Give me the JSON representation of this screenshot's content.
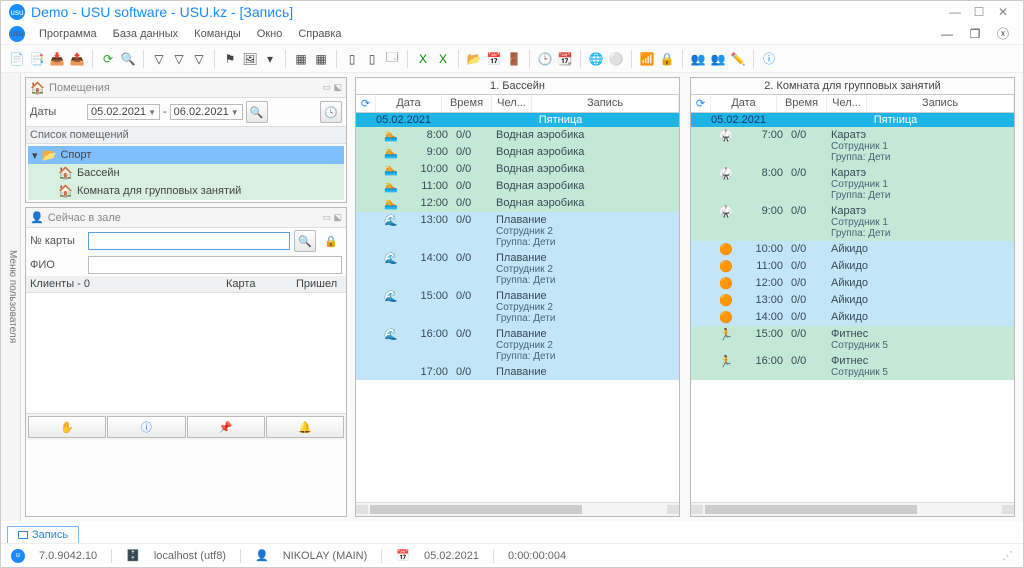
{
  "window_title": "Demo - USU software - USU.kz - [Запись]",
  "menubar": [
    "Программа",
    "База данных",
    "Команды",
    "Окно",
    "Справка"
  ],
  "usermenu_label": "Меню пользователя",
  "rooms_panel": {
    "title": "Помещения",
    "dates_label": "Даты",
    "date_from": "05.02.2021",
    "date_to": "06.02.2021",
    "list_title": "Список помещений",
    "tree": {
      "root": "Спорт",
      "items": [
        "Бассейн",
        "Комната для групповых занятий"
      ]
    }
  },
  "now_panel": {
    "title": "Сейчас в зале",
    "card_label": "№ карты",
    "fio_label": "ФИО",
    "clients_label": "Клиенты - 0",
    "col_card": "Карта",
    "col_came": "Пришел"
  },
  "sched1": {
    "title": "1. Бассейн",
    "cols": [
      "Дата",
      "Время",
      "Чел...",
      "Запись"
    ],
    "day_date": "05.02.2021",
    "day_name": "Пятница",
    "rows": [
      {
        "bg": 1,
        "ic": "swim",
        "time": "8:00",
        "cap": "0/0",
        "txt": "Водная аэробика"
      },
      {
        "bg": 1,
        "ic": "swim",
        "time": "9:00",
        "cap": "0/0",
        "txt": "Водная аэробика"
      },
      {
        "bg": 1,
        "ic": "swim",
        "time": "10:00",
        "cap": "0/0",
        "txt": "Водная аэробика"
      },
      {
        "bg": 1,
        "ic": "swim",
        "time": "11:00",
        "cap": "0/0",
        "txt": "Водная аэробика"
      },
      {
        "bg": 1,
        "ic": "swim",
        "time": "12:00",
        "cap": "0/0",
        "txt": "Водная аэробика"
      },
      {
        "bg": 2,
        "ic": "wave",
        "time": "13:00",
        "cap": "0/0",
        "txt": "Плавание",
        "sub": "Сотрудник 2\nГруппа: Дети"
      },
      {
        "bg": 2,
        "ic": "wave",
        "time": "14:00",
        "cap": "0/0",
        "txt": "Плавание",
        "sub": "Сотрудник 2\nГруппа: Дети"
      },
      {
        "bg": 2,
        "ic": "wave",
        "time": "15:00",
        "cap": "0/0",
        "txt": "Плавание",
        "sub": "Сотрудник 2\nГруппа: Дети"
      },
      {
        "bg": 2,
        "ic": "wave",
        "time": "16:00",
        "cap": "0/0",
        "txt": "Плавание",
        "sub": "Сотрудник 2\nГруппа: Дети"
      },
      {
        "bg": 2,
        "ic": "",
        "time": "17:00",
        "cap": "0/0",
        "txt": "Плавание"
      }
    ]
  },
  "sched2": {
    "title": "2. Комната для групповых занятий",
    "cols": [
      "Дата",
      "Время",
      "Чел...",
      "Запись"
    ],
    "day_date": "05.02.2021",
    "day_name": "Пятница",
    "rows": [
      {
        "bg": 1,
        "ic": "karate",
        "time": "7:00",
        "cap": "0/0",
        "txt": "Каратэ",
        "sub": "Сотрудник 1\nГруппа: Дети"
      },
      {
        "bg": 1,
        "ic": "karate",
        "time": "8:00",
        "cap": "0/0",
        "txt": "Каратэ",
        "sub": "Сотрудник 1\nГруппа: Дети"
      },
      {
        "bg": 1,
        "ic": "karate",
        "time": "9:00",
        "cap": "0/0",
        "txt": "Каратэ",
        "sub": "Сотрудник 1\nГруппа: Дети"
      },
      {
        "bg": 2,
        "ic": "aikido",
        "time": "10:00",
        "cap": "0/0",
        "txt": "Айкидо"
      },
      {
        "bg": 2,
        "ic": "aikido",
        "time": "11:00",
        "cap": "0/0",
        "txt": "Айкидо"
      },
      {
        "bg": 2,
        "ic": "aikido",
        "time": "12:00",
        "cap": "0/0",
        "txt": "Айкидо"
      },
      {
        "bg": 2,
        "ic": "aikido",
        "time": "13:00",
        "cap": "0/0",
        "txt": "Айкидо"
      },
      {
        "bg": 2,
        "ic": "aikido",
        "time": "14:00",
        "cap": "0/0",
        "txt": "Айкидо"
      },
      {
        "bg": 1,
        "ic": "run",
        "time": "15:00",
        "cap": "0/0",
        "txt": "Фитнес",
        "sub": "Сотрудник 5"
      },
      {
        "bg": 1,
        "ic": "run",
        "time": "16:00",
        "cap": "0/0",
        "txt": "Фитнес",
        "sub": "Сотрудник 5"
      }
    ]
  },
  "tab_label": "Запись",
  "status": {
    "version": "7.0.9042.10",
    "host": "localhost (utf8)",
    "user": "NIKOLAY (MAIN)",
    "date": "05.02.2021",
    "timer": "0:00:00:004"
  }
}
